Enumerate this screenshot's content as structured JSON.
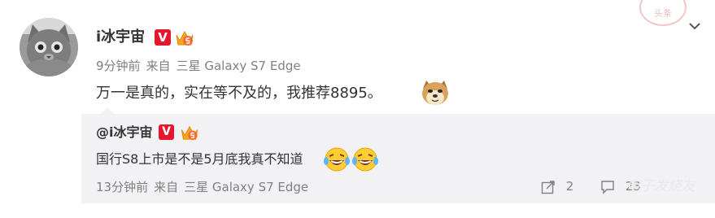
{
  "post": {
    "username": "i冰宇宙",
    "verified_badge": "V",
    "time": "9分钟前",
    "source_prefix": "来自",
    "source_device": "三星 Galaxy S7 Edge",
    "text": "万一是真的，实在等不及的，我推荐8895。"
  },
  "repost": {
    "username": "@i冰宇宙",
    "verified_badge": "V",
    "text": "国行S8上市是不是5月底我真不知道",
    "time": "13分钟前",
    "source_prefix": "来自",
    "source_device": "三星 Galaxy S7 Edge",
    "share_count": "2",
    "comment_count": "23"
  },
  "watermark": {
    "stamp": "头条",
    "text": "电子发烧友"
  },
  "icons": {
    "menu": "chevron-down-icon",
    "share": "share-icon",
    "comment": "comment-icon",
    "level": "crown-level-icon",
    "emoji_post": "doge-emoji-icon",
    "emoji_repost": "laughing-tears-emoji-icon"
  },
  "colors": {
    "verified": "#e6162d",
    "meta": "#808080",
    "repost_bg": "#f2f2f5"
  }
}
